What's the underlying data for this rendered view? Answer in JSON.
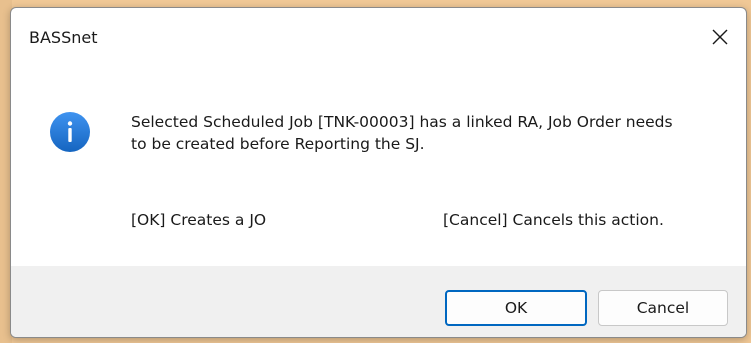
{
  "dialog": {
    "title": "BASSnet",
    "close_icon": "close-icon",
    "info_icon": "info-icon",
    "message": "Selected Scheduled Job [TNK-00003] has a linked RA, Job Order needs to be created before Reporting the SJ.",
    "ok_note": "[OK] Creates a JO",
    "cancel_note": "[Cancel] Cancels this action.",
    "ok_label": "OK",
    "cancel_label": "Cancel"
  },
  "colors": {
    "accent": "#0067c0",
    "info_icon": "#1a73e8"
  }
}
